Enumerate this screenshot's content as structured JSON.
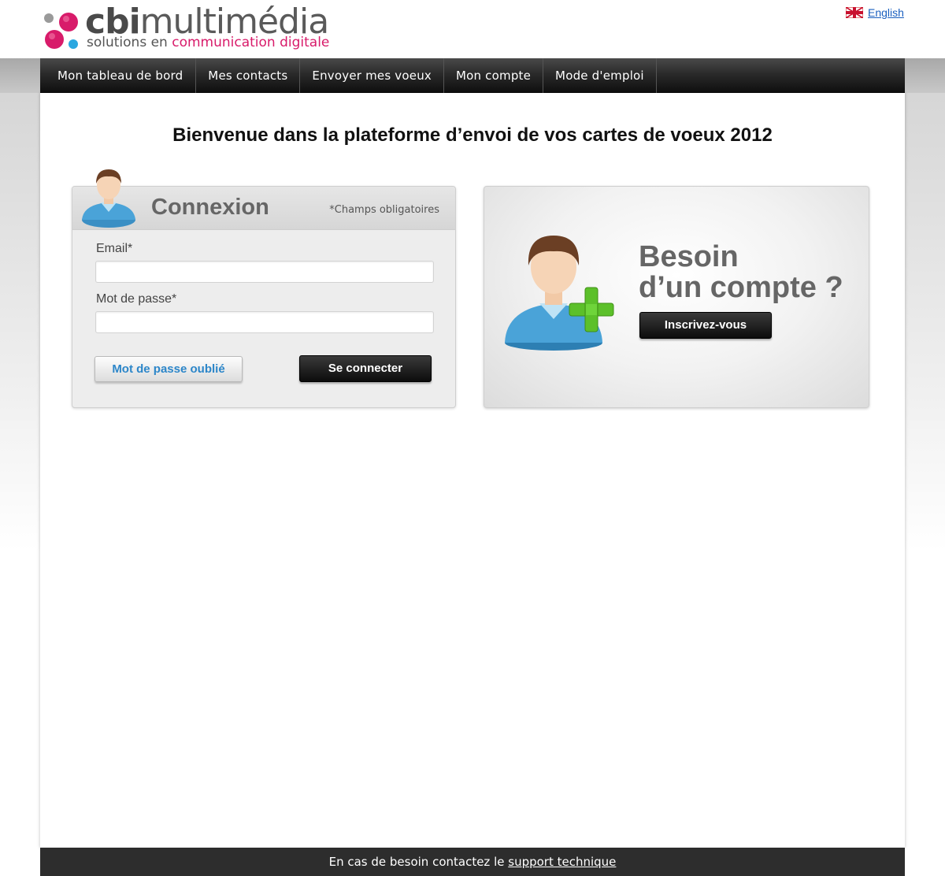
{
  "brand": {
    "name_bold": "cbi",
    "name_rest": "multimédia",
    "tagline_start": "solutions en ",
    "tagline_highlight": "communication digitale",
    "colors": {
      "pink": "#d81b6a",
      "blue": "#2aa7e0",
      "gray": "#9a9a9a"
    }
  },
  "language": {
    "link_label": "English",
    "icon": "uk-flag-icon"
  },
  "nav": {
    "items": [
      {
        "label": "Mon tableau de bord"
      },
      {
        "label": "Mes contacts"
      },
      {
        "label": "Envoyer mes voeux"
      },
      {
        "label": "Mon compte"
      },
      {
        "label": "Mode d'emploi"
      }
    ]
  },
  "main": {
    "welcome_title": "Bienvenue dans la plateforme d’envoi de vos cartes de voeux 2012"
  },
  "login": {
    "title": "Connexion",
    "required_note": "*Champs obligatoires",
    "email_label": "Email*",
    "email_value": "",
    "password_label": "Mot de passe*",
    "password_value": "",
    "forgot_label": "Mot de passe oublié",
    "submit_label": "Se connecter",
    "icon": "user-avatar-icon"
  },
  "signup": {
    "title_line1": "Besoin",
    "title_line2": "d’un compte ?",
    "button_label": "Inscrivez-vous",
    "icon": "user-add-icon"
  },
  "footer": {
    "text": "En cas de besoin contactez le ",
    "link_label": "support technique"
  }
}
